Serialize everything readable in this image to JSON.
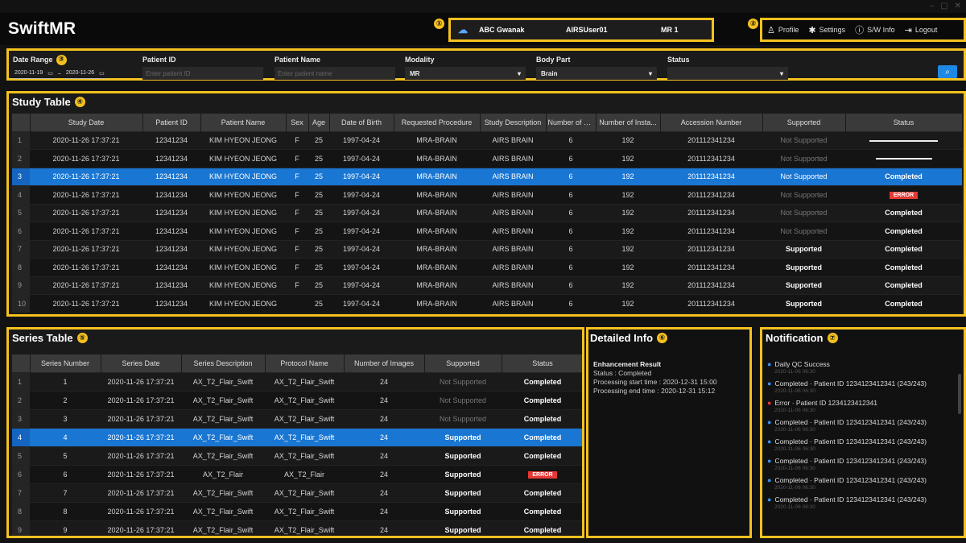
{
  "window": {
    "min": "–",
    "max": "▢",
    "close": "✕"
  },
  "app": {
    "title": "SwiftMR"
  },
  "markers": [
    "①",
    "②",
    "③",
    "④",
    "⑤",
    "⑥",
    "⑦"
  ],
  "topbar": {
    "site": "ABC Gwanak",
    "user": "AIRSUser01",
    "device": "MR 1"
  },
  "header_menu": {
    "profile": "Profile",
    "settings": "Settings",
    "swinfo": "S/W Info",
    "logout": "Logout"
  },
  "filters": {
    "date_range_label": "Date Range",
    "date_from": "2020-11-19",
    "date_to": "2020-11-26",
    "patient_id_label": "Patient ID",
    "patient_id_placeholder": "Enter patient ID",
    "patient_name_label": "Patient Name",
    "patient_name_placeholder": "Enter patient name",
    "modality_label": "Modality",
    "modality_value": "MR",
    "body_part_label": "Body Part",
    "body_part_value": "Brain",
    "status_label": "Status",
    "status_value": ""
  },
  "study": {
    "title": "Study Table",
    "columns": [
      "",
      "Study Date",
      "Patient ID",
      "Patient Name",
      "Sex",
      "Age",
      "Date of Birth",
      "Requested Procedure",
      "Study Description",
      "Number of S...",
      "Number of Insta...",
      "Accession Number",
      "Supported",
      "Status"
    ],
    "rows": [
      {
        "no": "1",
        "date": "2020-11-26 17:37:21",
        "pid": "12341234",
        "name": "KIM HYEON JEONG",
        "sex": "F",
        "age": "25",
        "dob": "1997-04-24",
        "proc": "MRA-BRAIN",
        "desc": "AIRS BRAIN",
        "ns": "6",
        "ni": "192",
        "acc": "201112341234",
        "supported": "Not Supported",
        "status": "progress",
        "progress": 0.85
      },
      {
        "no": "2",
        "date": "2020-11-26 17:37:21",
        "pid": "12341234",
        "name": "KIM HYEON JEONG",
        "sex": "F",
        "age": "25",
        "dob": "1997-04-24",
        "proc": "MRA-BRAIN",
        "desc": "AIRS BRAIN",
        "ns": "6",
        "ni": "192",
        "acc": "201112341234",
        "supported": "Not Supported",
        "status": "progress",
        "progress": 0.7
      },
      {
        "no": "3",
        "date": "2020-11-26 17:37:21",
        "pid": "12341234",
        "name": "KIM HYEON JEONG",
        "sex": "F",
        "age": "25",
        "dob": "1997-04-24",
        "proc": "MRA-BRAIN",
        "desc": "AIRS BRAIN",
        "ns": "6",
        "ni": "192",
        "acc": "201112341234",
        "supported": "Not Supported",
        "status": "Completed",
        "selected": true
      },
      {
        "no": "4",
        "date": "2020-11-26 17:37:21",
        "pid": "12341234",
        "name": "KIM HYEON JEONG",
        "sex": "F",
        "age": "25",
        "dob": "1997-04-24",
        "proc": "MRA-BRAIN",
        "desc": "AIRS BRAIN",
        "ns": "6",
        "ni": "192",
        "acc": "201112341234",
        "supported": "Not Supported",
        "status": "ERROR"
      },
      {
        "no": "5",
        "date": "2020-11-26 17:37:21",
        "pid": "12341234",
        "name": "KIM HYEON JEONG",
        "sex": "F",
        "age": "25",
        "dob": "1997-04-24",
        "proc": "MRA-BRAIN",
        "desc": "AIRS BRAIN",
        "ns": "6",
        "ni": "192",
        "acc": "201112341234",
        "supported": "Not Supported",
        "status": "Completed"
      },
      {
        "no": "6",
        "date": "2020-11-26 17:37:21",
        "pid": "12341234",
        "name": "KIM HYEON JEONG",
        "sex": "F",
        "age": "25",
        "dob": "1997-04-24",
        "proc": "MRA-BRAIN",
        "desc": "AIRS BRAIN",
        "ns": "6",
        "ni": "192",
        "acc": "201112341234",
        "supported": "Not Supported",
        "status": "Completed"
      },
      {
        "no": "7",
        "date": "2020-11-26 17:37:21",
        "pid": "12341234",
        "name": "KIM HYEON JEONG",
        "sex": "F",
        "age": "25",
        "dob": "1997-04-24",
        "proc": "MRA-BRAIN",
        "desc": "AIRS BRAIN",
        "ns": "6",
        "ni": "192",
        "acc": "201112341234",
        "supported": "Supported",
        "status": "Completed"
      },
      {
        "no": "8",
        "date": "2020-11-26 17:37:21",
        "pid": "12341234",
        "name": "KIM HYEON JEONG",
        "sex": "F",
        "age": "25",
        "dob": "1997-04-24",
        "proc": "MRA-BRAIN",
        "desc": "AIRS BRAIN",
        "ns": "6",
        "ni": "192",
        "acc": "201112341234",
        "supported": "Supported",
        "status": "Completed"
      },
      {
        "no": "9",
        "date": "2020-11-26 17:37:21",
        "pid": "12341234",
        "name": "KIM HYEON JEONG",
        "sex": "F",
        "age": "25",
        "dob": "1997-04-24",
        "proc": "MRA-BRAIN",
        "desc": "AIRS BRAIN",
        "ns": "6",
        "ni": "192",
        "acc": "201112341234",
        "supported": "Supported",
        "status": "Completed"
      },
      {
        "no": "10",
        "date": "2020-11-26 17:37:21",
        "pid": "12341234",
        "name": "KIM HYEON JEONG",
        "sex": "",
        "age": "25",
        "dob": "1997-04-24",
        "proc": "MRA-BRAIN",
        "desc": "AIRS BRAIN",
        "ns": "6",
        "ni": "192",
        "acc": "201112341234",
        "supported": "Supported",
        "status": "Completed"
      }
    ]
  },
  "series": {
    "title": "Series Table",
    "columns": [
      "",
      "Series Number",
      "Series Date",
      "Series Description",
      "Protocol Name",
      "Number of Images",
      "Supported",
      "Status"
    ],
    "rows": [
      {
        "no": "1",
        "num": "1",
        "date": "2020-11-26 17:37:21",
        "desc": "AX_T2_Flair_Swift",
        "proto": "AX_T2_Flair_Swift",
        "imgs": "24",
        "supported": "Not Supported",
        "status": "Completed"
      },
      {
        "no": "2",
        "num": "2",
        "date": "2020-11-26 17:37:21",
        "desc": "AX_T2_Flair_Swift",
        "proto": "AX_T2_Flair_Swift",
        "imgs": "24",
        "supported": "Not Supported",
        "status": "Completed"
      },
      {
        "no": "3",
        "num": "3",
        "date": "2020-11-26 17:37:21",
        "desc": "AX_T2_Flair_Swift",
        "proto": "AX_T2_Flair_Swift",
        "imgs": "24",
        "supported": "Not Supported",
        "status": "Completed"
      },
      {
        "no": "4",
        "num": "4",
        "date": "2020-11-26 17:37:21",
        "desc": "AX_T2_Flair_Swift",
        "proto": "AX_T2_Flair_Swift",
        "imgs": "24",
        "supported": "Supported",
        "status": "Completed",
        "selected": true
      },
      {
        "no": "5",
        "num": "5",
        "date": "2020-11-26 17:37:21",
        "desc": "AX_T2_Flair_Swift",
        "proto": "AX_T2_Flair_Swift",
        "imgs": "24",
        "supported": "Supported",
        "status": "Completed"
      },
      {
        "no": "6",
        "num": "6",
        "date": "2020-11-26 17:37:21",
        "desc": "AX_T2_Flair",
        "proto": "AX_T2_Flair",
        "imgs": "24",
        "supported": "Supported",
        "status": "ERROR"
      },
      {
        "no": "7",
        "num": "7",
        "date": "2020-11-26 17:37:21",
        "desc": "AX_T2_Flair_Swift",
        "proto": "AX_T2_Flair_Swift",
        "imgs": "24",
        "supported": "Supported",
        "status": "Completed"
      },
      {
        "no": "8",
        "num": "8",
        "date": "2020-11-26 17:37:21",
        "desc": "AX_T2_Flair_Swift",
        "proto": "AX_T2_Flair_Swift",
        "imgs": "24",
        "supported": "Supported",
        "status": "Completed"
      },
      {
        "no": "9",
        "num": "9",
        "date": "2020-11-26 17:37:21",
        "desc": "AX_T2_Flair_Swift",
        "proto": "AX_T2_Flair_Swift",
        "imgs": "24",
        "supported": "Supported",
        "status": "Completed"
      }
    ]
  },
  "detail": {
    "title": "Detailed Info",
    "heading": "Enhancement Result",
    "status": "Status : Completed",
    "start": "Processing start time : 2020-12-31 15:00",
    "end": "Processing end time : 2020-12-31 15:12"
  },
  "notification": {
    "title": "Notification",
    "items": [
      {
        "msg": "Daily QC Success",
        "ts": "2020-11-06 06:30",
        "color": "#3b8fe8"
      },
      {
        "msg": "Completed · Patient ID 1234123412341 (243/243)",
        "ts": "2020-11-06 06:30",
        "color": "#3b8fe8"
      },
      {
        "msg": "Error · Patient ID 1234123412341",
        "ts": "2020-11-06 06:30",
        "color": "#e53935"
      },
      {
        "msg": "Completed · Patient ID 1234123412341 (243/243)",
        "ts": "2020-11-06 06:30",
        "color": "#3b8fe8"
      },
      {
        "msg": "Completed · Patient ID 1234123412341 (243/243)",
        "ts": "2020-11-06 06:30",
        "color": "#3b8fe8"
      },
      {
        "msg": "Completed · Patient ID 1234123412341 (243/243)",
        "ts": "2020-11-06 06:30",
        "color": "#3b8fe8"
      },
      {
        "msg": "Completed · Patient ID 1234123412341 (243/243)",
        "ts": "2020-11-06 06:30",
        "color": "#3b8fe8"
      },
      {
        "msg": "Completed · Patient ID 1234123412341 (243/243)",
        "ts": "2020-11-06 06:30",
        "color": "#3b8fe8"
      }
    ]
  },
  "icons": {
    "cloud": "☁",
    "profile": "♙",
    "settings": "✱",
    "info": "ⓘ",
    "logout": "⇥",
    "calendar": "▭",
    "chevron": "▾",
    "search": "⌕"
  }
}
